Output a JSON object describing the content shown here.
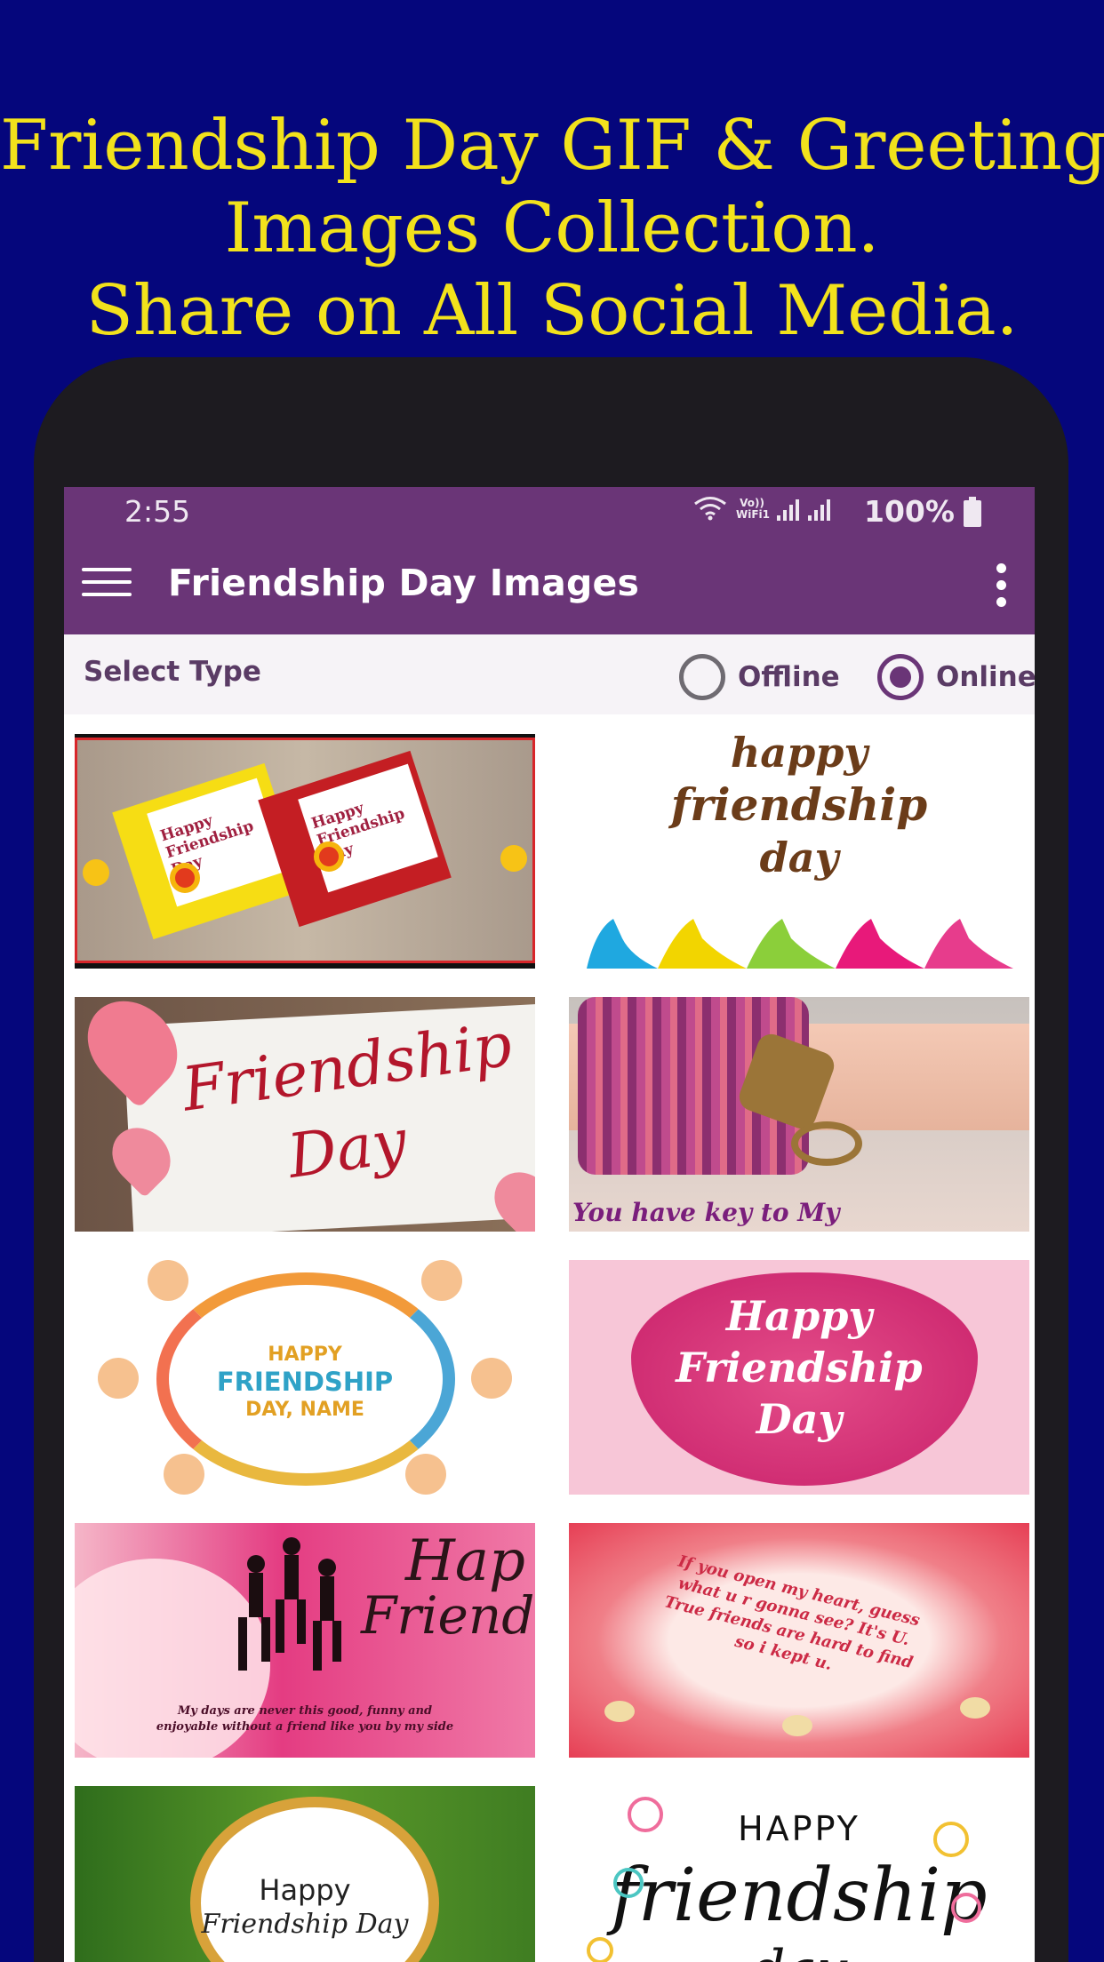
{
  "promo": {
    "line1": "Friendship Day GIF & Greeting",
    "line2": "Images Collection.",
    "line3": "Share on All Social Media."
  },
  "status": {
    "time": "2:55",
    "volte_label": "Vo)) WiFi1",
    "battery": "100%"
  },
  "appbar": {
    "title": "Friendship Day Images",
    "menu_icon": "hamburger-menu-icon",
    "overflow_icon": "more-vert-icon"
  },
  "type_selector": {
    "label": "Select Type",
    "options": [
      {
        "label": "Offline",
        "selected": false
      },
      {
        "label": "Online",
        "selected": true
      }
    ]
  },
  "images": [
    {
      "text": "Happy Friendship Day",
      "text2": "Happy Friendship Day",
      "style": "cards"
    },
    {
      "text": "happy",
      "text2": "friendship",
      "text3": "day",
      "style": "hands"
    },
    {
      "text": "Friendship",
      "text2": "Day",
      "style": "hearts"
    },
    {
      "text": "You have key to My",
      "style": "bracelet"
    },
    {
      "text": "HAPPY",
      "text2": "FRIENDSHIP",
      "text3": "DAY, NAME",
      "style": "circle"
    },
    {
      "text": "Happy",
      "text2": "Friendship",
      "text3": "Day",
      "style": "pinkheart"
    },
    {
      "text": "Hap",
      "text2": "Friends",
      "text3": "My days are never this good, funny and",
      "text4": "enjoyable without a friend like you by my side",
      "style": "silhouette"
    },
    {
      "text": "If you open my heart, guess what u r gonna see? It's U. True friends are hard to find so i kept u.",
      "style": "petals"
    },
    {
      "text": "Happy",
      "text2": "Friendship Day",
      "style": "greenframe"
    },
    {
      "text": "HAPPY",
      "text2": "friendship",
      "text3": "day",
      "style": "flowers"
    }
  ],
  "colors": {
    "background": "#05067c",
    "promo_text": "#f2e21c",
    "app_primary": "#6a3577"
  }
}
